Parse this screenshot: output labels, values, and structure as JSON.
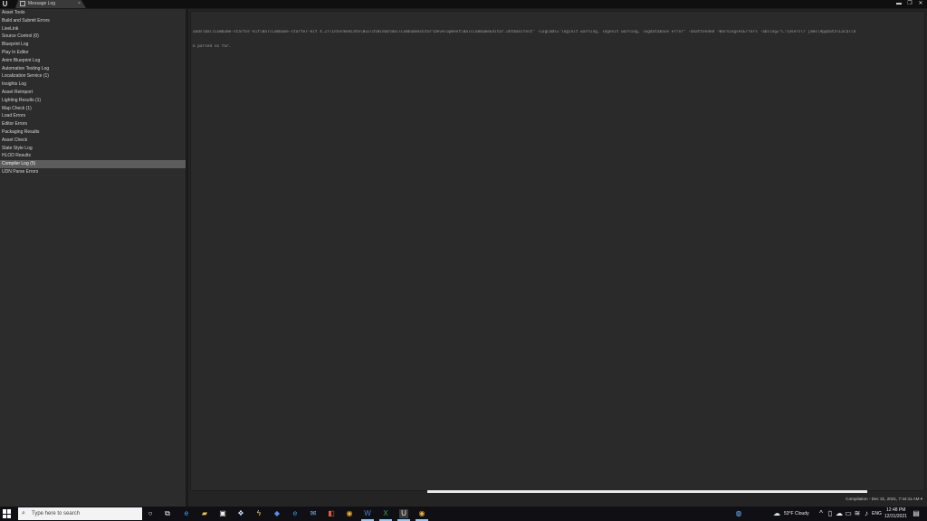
{
  "window": {
    "app_logo": "U",
    "tab_label": "Message Log",
    "tab_close": "×",
    "buttons": {
      "minimize": "▬",
      "maximize": "❐",
      "close": "✕"
    }
  },
  "sidebar": {
    "items": [
      {
        "label": "Asset Tools"
      },
      {
        "label": "Build and Submit Errors"
      },
      {
        "label": "LiveLink"
      },
      {
        "label": "Source Control (0)"
      },
      {
        "label": "Blueprint Log"
      },
      {
        "label": "Play In Editor"
      },
      {
        "label": "Anim Blueprint Log"
      },
      {
        "label": "Automation Testing Log"
      },
      {
        "label": "Localization Service (1)"
      },
      {
        "label": "Insights Log"
      },
      {
        "label": "Asset Reimport"
      },
      {
        "label": "Lighting Results (1)"
      },
      {
        "label": "Map Check (1)"
      },
      {
        "label": "Load Errors"
      },
      {
        "label": "Editor Errors"
      },
      {
        "label": "Packaging Results"
      },
      {
        "label": "Asset Check"
      },
      {
        "label": "Slate Style Log"
      },
      {
        "label": "HLOD Results"
      },
      {
        "label": "Compiler Log (5)"
      },
      {
        "label": "UDN Parse Errors"
      }
    ],
    "selected_index": 19
  },
  "log": {
    "lines": [
      "oads\\BallCombume-starter-kit\\BallCombume-starter-kit 4.27\\Intermediate\\Build\\Win64\\BallCombumeEditor\\Development\\BallCombumeEditor.uhtmanifest\" -LogCmds=\"loginit warning, logexit warning, logdatabase error\" -Unattended -WarningsAsErrors -abslog=\"C:\\Users\\r jams\\AppData\\Local\\U",
      "6 parsed so far."
    ],
    "status": "Compilation - Dec 31, 2021, 7:44:11 AM ▾"
  },
  "taskbar": {
    "search_placeholder": "Type here to search",
    "weather": "53°F Cloudy",
    "language": "ENG",
    "time": "12:48 PM",
    "date": "12/31/2021"
  }
}
